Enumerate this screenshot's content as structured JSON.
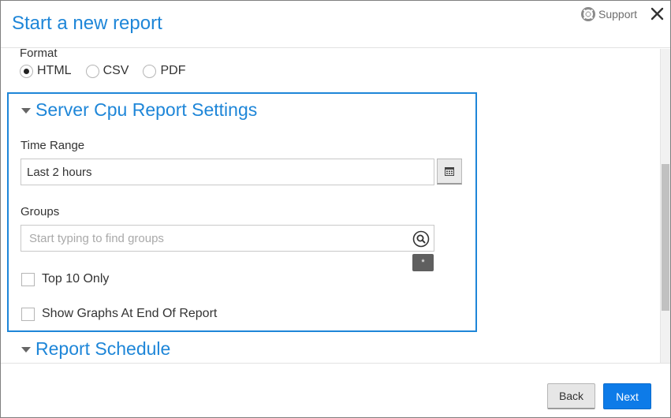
{
  "modal": {
    "title": "Start a new report",
    "support_label": "Support",
    "close_icon": "close-icon"
  },
  "format": {
    "label": "Format",
    "options": [
      {
        "label": "HTML",
        "selected": true
      },
      {
        "label": "CSV",
        "selected": false
      },
      {
        "label": "PDF",
        "selected": false
      }
    ]
  },
  "settings": {
    "title": "Server Cpu Report Settings",
    "time_range": {
      "label": "Time Range",
      "value": "Last 2 hours"
    },
    "groups": {
      "label": "Groups",
      "placeholder": "Start typing to find groups",
      "tag": "*"
    },
    "checkboxes": [
      {
        "label": "Top 10 Only",
        "checked": false
      },
      {
        "label": "Show Graphs At End Of Report",
        "checked": false
      }
    ]
  },
  "schedule": {
    "title": "Report Schedule"
  },
  "footer": {
    "back_label": "Back",
    "next_label": "Next"
  },
  "colors": {
    "accent": "#1e86d8",
    "primary_button": "#0d7be8"
  }
}
